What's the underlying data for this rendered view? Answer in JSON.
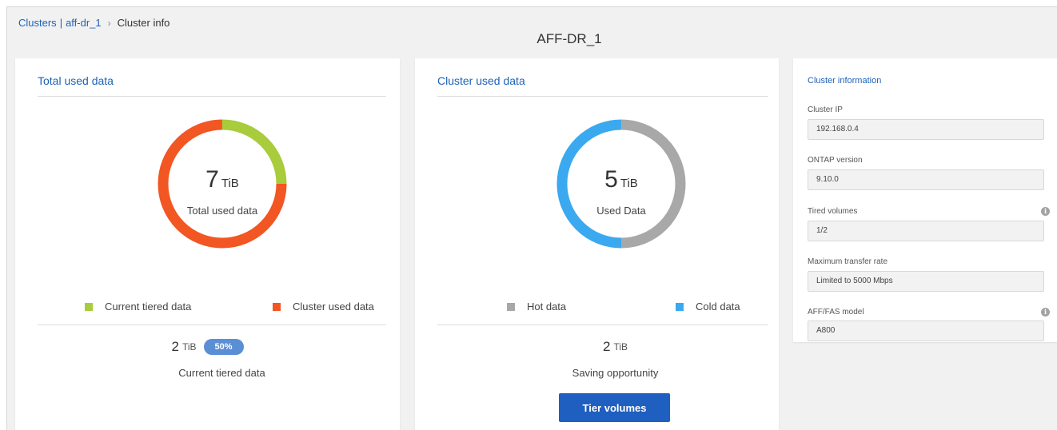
{
  "breadcrumb": {
    "clusters": "Clusters",
    "separator_bar": "|",
    "cluster": "aff-dr_1",
    "chevron": "›",
    "current": "Cluster info"
  },
  "page_title": "AFF-DR_1",
  "total_used": {
    "title": "Total used data",
    "value": "7",
    "unit": "TiB",
    "label": "Total used data",
    "ring": {
      "current_tiered_fraction": 0.25,
      "cluster_used_fraction": 0.75
    },
    "legend": [
      {
        "label": "Current tiered data",
        "color": "#a8cc3c"
      },
      {
        "label": "Cluster used data",
        "color": "#f25623"
      }
    ],
    "summary": {
      "value": "2",
      "unit": "TiB",
      "badge": "50%",
      "label": "Current tiered data"
    }
  },
  "cluster_used": {
    "title": "Cluster used data",
    "value": "5",
    "unit": "TiB",
    "label": "Used Data",
    "ring": {
      "hot_fraction": 0.5,
      "cold_fraction": 0.5
    },
    "legend": [
      {
        "label": "Hot data",
        "color": "#a8a8a8"
      },
      {
        "label": "Cold data",
        "color": "#3aa9ef"
      }
    ],
    "summary": {
      "value": "2",
      "unit": "TiB",
      "label": "Saving opportunity"
    },
    "button": "Tier volumes"
  },
  "cluster_info": {
    "title": "Cluster information",
    "fields": [
      {
        "label": "Cluster IP",
        "value": "192.168.0.4",
        "info_icon": false
      },
      {
        "label": "ONTAP version",
        "value": "9.10.0",
        "info_icon": false
      },
      {
        "label": "Tired volumes",
        "value": "1/2",
        "info_icon": true
      },
      {
        "label": "Maximum transfer rate",
        "value": "Limited to 5000 Mbps",
        "info_icon": false
      },
      {
        "label": "AFF/FAS model",
        "value": "A800",
        "info_icon": true
      }
    ],
    "info_icon_glyph": "i"
  }
}
